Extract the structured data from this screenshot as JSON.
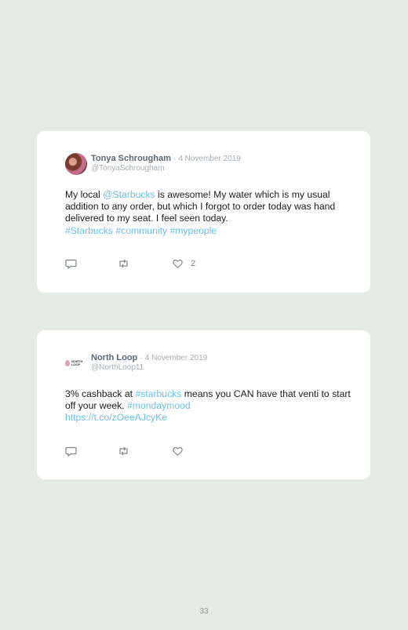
{
  "tweets": [
    {
      "author": "Tonya Schrougham",
      "separator": "·",
      "date": "4 November 2019",
      "handle": "@TonyaSchrougham",
      "text_1": "My local ",
      "mention": "@Starbucks",
      "text_2": " is awesome! My water which is my usual addition to any order, but which I forgot to order today was hand delivered to my seat. I feel seen today.",
      "hashtags": "#Starbucks #community #mypeople",
      "likes": "2",
      "icons": [
        "reply-icon",
        "retweet-icon",
        "heart-icon"
      ]
    },
    {
      "author": "North Loop",
      "separator": "·",
      "date": "4 November 2019",
      "handle": "@NorthLoop11",
      "avatar_text": "NORTH LOOP",
      "text_1": "3% cashback at ",
      "hashtag_inline": "#starbucks",
      "text_2": " means you CAN have that venti to start off your week. ",
      "hashtag_end": "#mondaymood",
      "url": "https://t.co/zOeeAJcyKe",
      "icons": [
        "reply-icon",
        "retweet-icon",
        "heart-icon"
      ]
    }
  ],
  "page_number": "33",
  "colors": {
    "background": "#e3ebe5",
    "card": "#ffffff",
    "link": "#6cc0e6",
    "muted": "#a6aeb3"
  }
}
